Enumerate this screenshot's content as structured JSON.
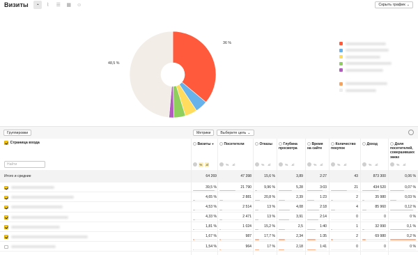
{
  "header": {
    "title": "Визиты",
    "hide_chart_label": "Скрыть график",
    "chart_views": [
      "pie-chart-icon",
      "line-chart-icon",
      "bar-chart-icon",
      "grid-icon",
      "person-icon"
    ]
  },
  "chart": {
    "label_large": "36 %",
    "label_other": "48,5 %",
    "colors": [
      "#ff5a3c",
      "#67b2ea",
      "#ffdc5e",
      "#8fcf5e",
      "#b25bbf",
      "#f2eee7"
    ],
    "legend_colors": [
      "#ff5a3c",
      "#67b2ea",
      "#ffdc5e",
      "#8fcf5e",
      "#b25bbf",
      "#f4a460",
      "#eeeeee"
    ]
  },
  "chart_data": {
    "type": "pie",
    "slices": [
      {
        "value": 36.0,
        "color": "#ff5a3c"
      },
      {
        "value": 4.65,
        "color": "#67b2ea"
      },
      {
        "value": 4.53,
        "color": "#ffdc5e"
      },
      {
        "value": 4.33,
        "color": "#8fcf5e"
      },
      {
        "value": 1.81,
        "color": "#b25bbf"
      },
      {
        "value": 48.5,
        "color": "#f2eee7"
      }
    ],
    "donut": true
  },
  "toolbar": {
    "groupings_label": "Группировки",
    "metrics_label": "Метрики",
    "goal_label": "Выберите цель"
  },
  "table": {
    "dimension_header": "Страница входа",
    "find_placeholder": "Найти",
    "columns": [
      {
        "label": "Визиты",
        "sort": "▼"
      },
      {
        "label": "Посетители"
      },
      {
        "label": "Отказы"
      },
      {
        "label": "Глубина просмотра"
      },
      {
        "label": "Время на сайте"
      },
      {
        "label": "Количество покупок"
      },
      {
        "label": "Доход"
      },
      {
        "label": "Доля посетителей, совершивших заказ"
      }
    ],
    "totals_label": "Итого и средние",
    "totals": [
      "64 269",
      "47 398",
      "15,6 %",
      "3,89",
      "2:27",
      "43",
      "873 300",
      "0,06 %"
    ],
    "rows": [
      {
        "checked": true,
        "values": [
          "39,5 %",
          "21 790",
          "9,96 %",
          "5,28",
          "3:03",
          "21",
          "434 520",
          "0,07 %"
        ],
        "bars": [
          0.9,
          0.5,
          0.12,
          0.55,
          0.8,
          0.6,
          0.7,
          0.55
        ]
      },
      {
        "checked": true,
        "values": [
          "4,65 %",
          "2 881",
          "20,8 %",
          "2,39",
          "1:23",
          "2",
          "35 980",
          "0,03 %"
        ],
        "bars": [
          0.1,
          0.1,
          0.25,
          0.25,
          0.35,
          0.08,
          0.08,
          0.25
        ]
      },
      {
        "checked": true,
        "values": [
          "4,53 %",
          "2 514",
          "13 %",
          "4,08",
          "2:18",
          "4",
          "85 960",
          "0,12 %"
        ],
        "bars": [
          0.1,
          0.09,
          0.16,
          0.45,
          0.6,
          0.15,
          0.18,
          0.9
        ]
      },
      {
        "checked": true,
        "values": [
          "4,33 %",
          "2 471",
          "13 %",
          "3,91",
          "2:14",
          "0",
          "0",
          "0 %"
        ],
        "bars": [
          0.1,
          0.09,
          0.16,
          0.42,
          0.58,
          0,
          0,
          0
        ]
      },
      {
        "checked": true,
        "values": [
          "1,81 %",
          "1 024",
          "15,2 %",
          "2,5",
          "1:40",
          "1",
          "32 990",
          "0,1 %"
        ],
        "bars": [
          0.05,
          0.04,
          0.18,
          0.27,
          0.44,
          0.05,
          0.08,
          0.75
        ]
      },
      {
        "checked": true,
        "values": [
          "1,67 %",
          "987",
          "17,7 %",
          "2,34",
          "1:35",
          "2",
          "69 980",
          "0,2 %"
        ],
        "bars": [
          0.05,
          0.04,
          0.21,
          0.25,
          0.42,
          0.08,
          0.16,
          1
        ]
      },
      {
        "checked": false,
        "values": [
          "1,54 %",
          "964",
          "17 %",
          "2,18",
          "1:41",
          "0",
          "0",
          "0 %"
        ],
        "bars": [
          0.04,
          0.04,
          0.2,
          0.23,
          0.44,
          0,
          0,
          0
        ]
      }
    ]
  }
}
